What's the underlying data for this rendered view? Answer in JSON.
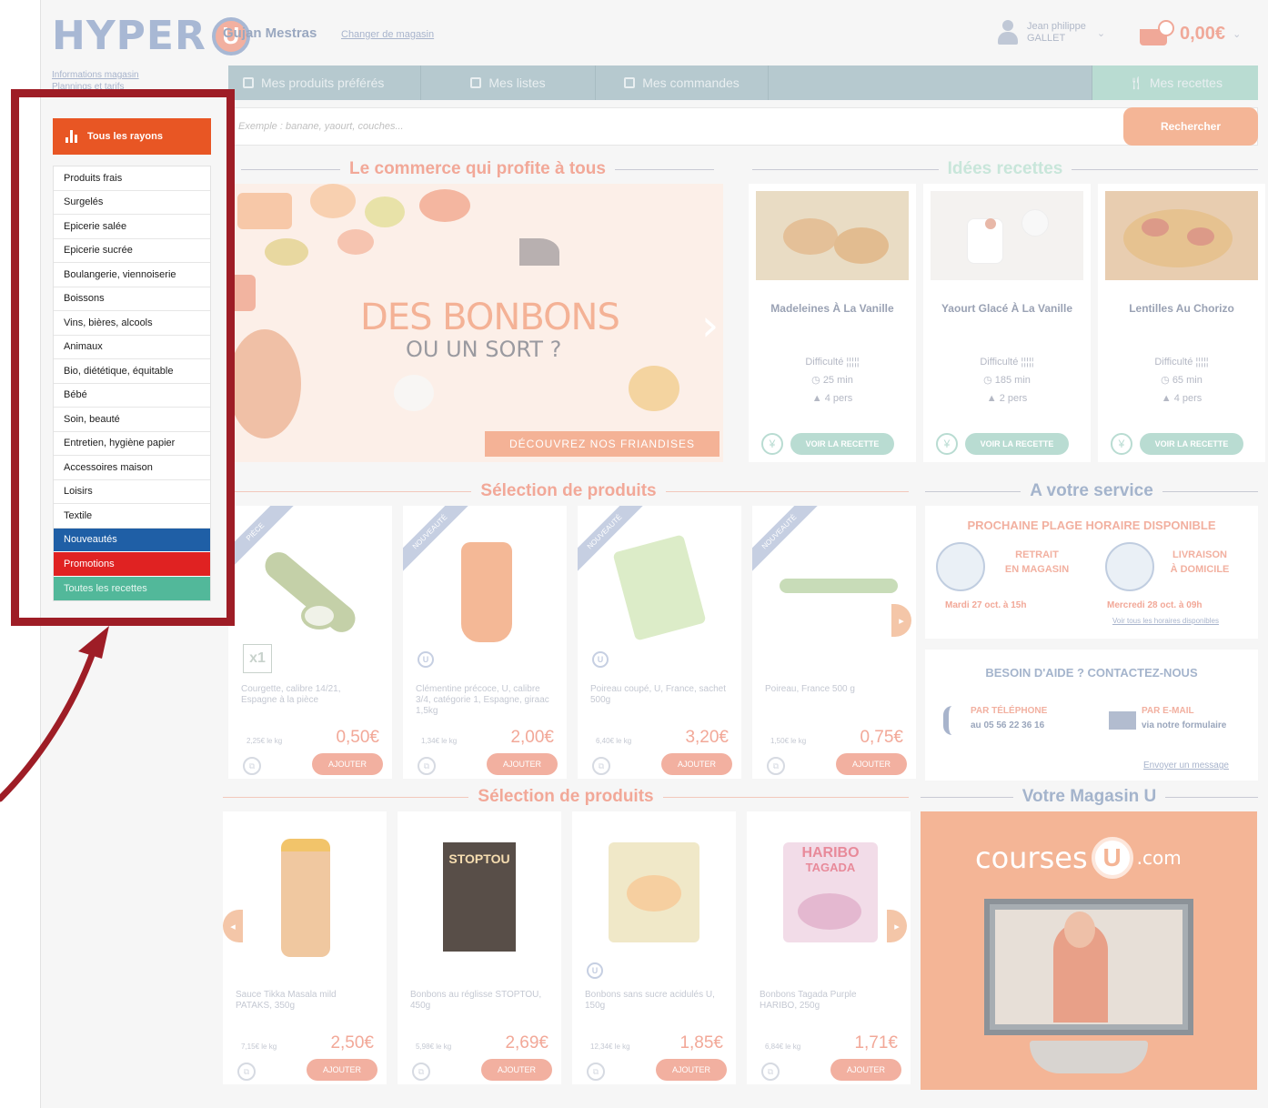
{
  "header": {
    "logo_text": "HYPER",
    "logo_u": "U",
    "store_name": "Gujan Mestras",
    "change_store": "Changer de magasin",
    "info_link": "Informations magasin",
    "plans_link": "Plannings et tarifs",
    "user_line1": "Jean philippe",
    "user_line2": "GALLET",
    "cart_amount": "0,00€"
  },
  "nav": {
    "tabs": [
      {
        "label": "Mes produits préférés",
        "icon": "star-icon"
      },
      {
        "label": "Mes listes",
        "icon": "list-icon"
      },
      {
        "label": "Mes commandes",
        "icon": "orders-icon"
      }
    ],
    "recipes_tab": "Mes recettes"
  },
  "search": {
    "placeholder": "Exemple : banane, yaourt, couches...",
    "button": "Rechercher"
  },
  "sections": {
    "commerce": "Le commerce qui profite à tous",
    "recipes": "Idées recettes",
    "selection1": "Sélection de produits",
    "service": "A votre service",
    "selection2": "Sélection de produits",
    "magasin": "Votre Magasin U"
  },
  "banner": {
    "title": "DES BONBONS",
    "subtitle": "OU UN SORT ?",
    "button": "DÉCOUVREZ NOS FRIANDISES"
  },
  "recipes": [
    {
      "name": "Madeleines À La Vanille",
      "difficulty_label": "Difficulté",
      "time": "25 min",
      "people": "4 pers",
      "button": "VOIR LA RECETTE"
    },
    {
      "name": "Yaourt Glacé À La Vanille",
      "difficulty_label": "Difficulté",
      "time": "185 min",
      "people": "2 pers",
      "button": "VOIR LA RECETTE"
    },
    {
      "name": "Lentilles Au Chorizo",
      "difficulty_label": "Difficulté",
      "time": "65 min",
      "people": "4 pers",
      "button": "VOIR LA RECETTE"
    }
  ],
  "products1": [
    {
      "ribbon": "PIÈCE",
      "badge": "x1",
      "name": "Courgette, calibre 14/21, Espagne à la pièce",
      "unit": "2,25€ le kg",
      "price": "0,50€",
      "add": "AJOUTER"
    },
    {
      "ribbon": "NOUVEAUTÉ",
      "name": "Clémentine précoce, U, calibre 3/4, catégorie 1, Espagne, giraac 1,5kg",
      "unit": "1,34€ le kg",
      "price": "2,00€",
      "add": "AJOUTER"
    },
    {
      "ribbon": "NOUVEAUTÉ",
      "name": "Poireau coupé, U, France, sachet 500g",
      "unit": "6,40€ le kg",
      "price": "3,20€",
      "add": "AJOUTER"
    },
    {
      "ribbon": "NOUVEAUTÉ",
      "name": "Poireau, France 500 g",
      "unit": "1,50€ le kg",
      "price": "0,75€",
      "add": "AJOUTER"
    }
  ],
  "products2": [
    {
      "name": "Sauce Tikka Masala mild PATAKS, 350g",
      "unit": "7,15€ le kg",
      "price": "2,50€",
      "add": "AJOUTER"
    },
    {
      "name": "Bonbons au réglisse STOPTOU, 450g",
      "unit": "5,98€ le kg",
      "price": "2,69€",
      "add": "AJOUTER",
      "pack": "STOPTOU"
    },
    {
      "name": "Bonbons sans sucre acidulés U, 150g",
      "unit": "12,34€ le kg",
      "price": "1,85€",
      "add": "AJOUTER"
    },
    {
      "name": "Bonbons Tagada Purple HARIBO, 250g",
      "unit": "6,84€ le kg",
      "price": "1,71€",
      "add": "AJOUTER",
      "pack": "HARIBO",
      "pack2": "TAGADA"
    }
  ],
  "service": {
    "heading": "PROCHAINE PLAGE HORAIRE DISPONIBLE",
    "retrait_1": "RETRAIT",
    "retrait_2": "EN MAGASIN",
    "retrait_date": "Mardi 27 oct. à 15h",
    "livraison_1": "LIVRAISON",
    "livraison_2": "À DOMICILE",
    "livraison_date": "Mercredi 28 oct. à 09h",
    "hours_link": "Voir tous les horaires disponibles"
  },
  "help": {
    "heading": "BESOIN D'AIDE ? CONTACTEZ-NOUS",
    "phone_label": "PAR TÉLÉPHONE",
    "phone_number": "au 05 56 22 36 16",
    "mail_label": "PAR E-MAIL",
    "mail_via": "via notre formulaire",
    "send_link": "Envoyer un message"
  },
  "courses": {
    "word": "courses",
    "u": "U",
    "com": ".com"
  },
  "sidebar": {
    "all": "Tous les rayons",
    "items": [
      "Produits frais",
      "Surgelés",
      "Epicerie salée",
      "Epicerie sucrée",
      "Boulangerie, viennoiserie",
      "Boissons",
      "Vins, bières, alcools",
      "Animaux",
      "Bio, diététique, équitable",
      "Bébé",
      "Soin, beauté",
      "Entretien, hygiène papier",
      "Accessoires maison",
      "Loisirs",
      "Textile"
    ],
    "nouveautes": "Nouveautés",
    "promotions": "Promotions",
    "recettes": "Toutes les recettes"
  },
  "colors": {
    "highlight_frame": "#9e1d26",
    "all_button": "#e85624",
    "nouveautes": "#1f5fa6",
    "promotions": "#e02222",
    "recettes": "#52b89a"
  }
}
